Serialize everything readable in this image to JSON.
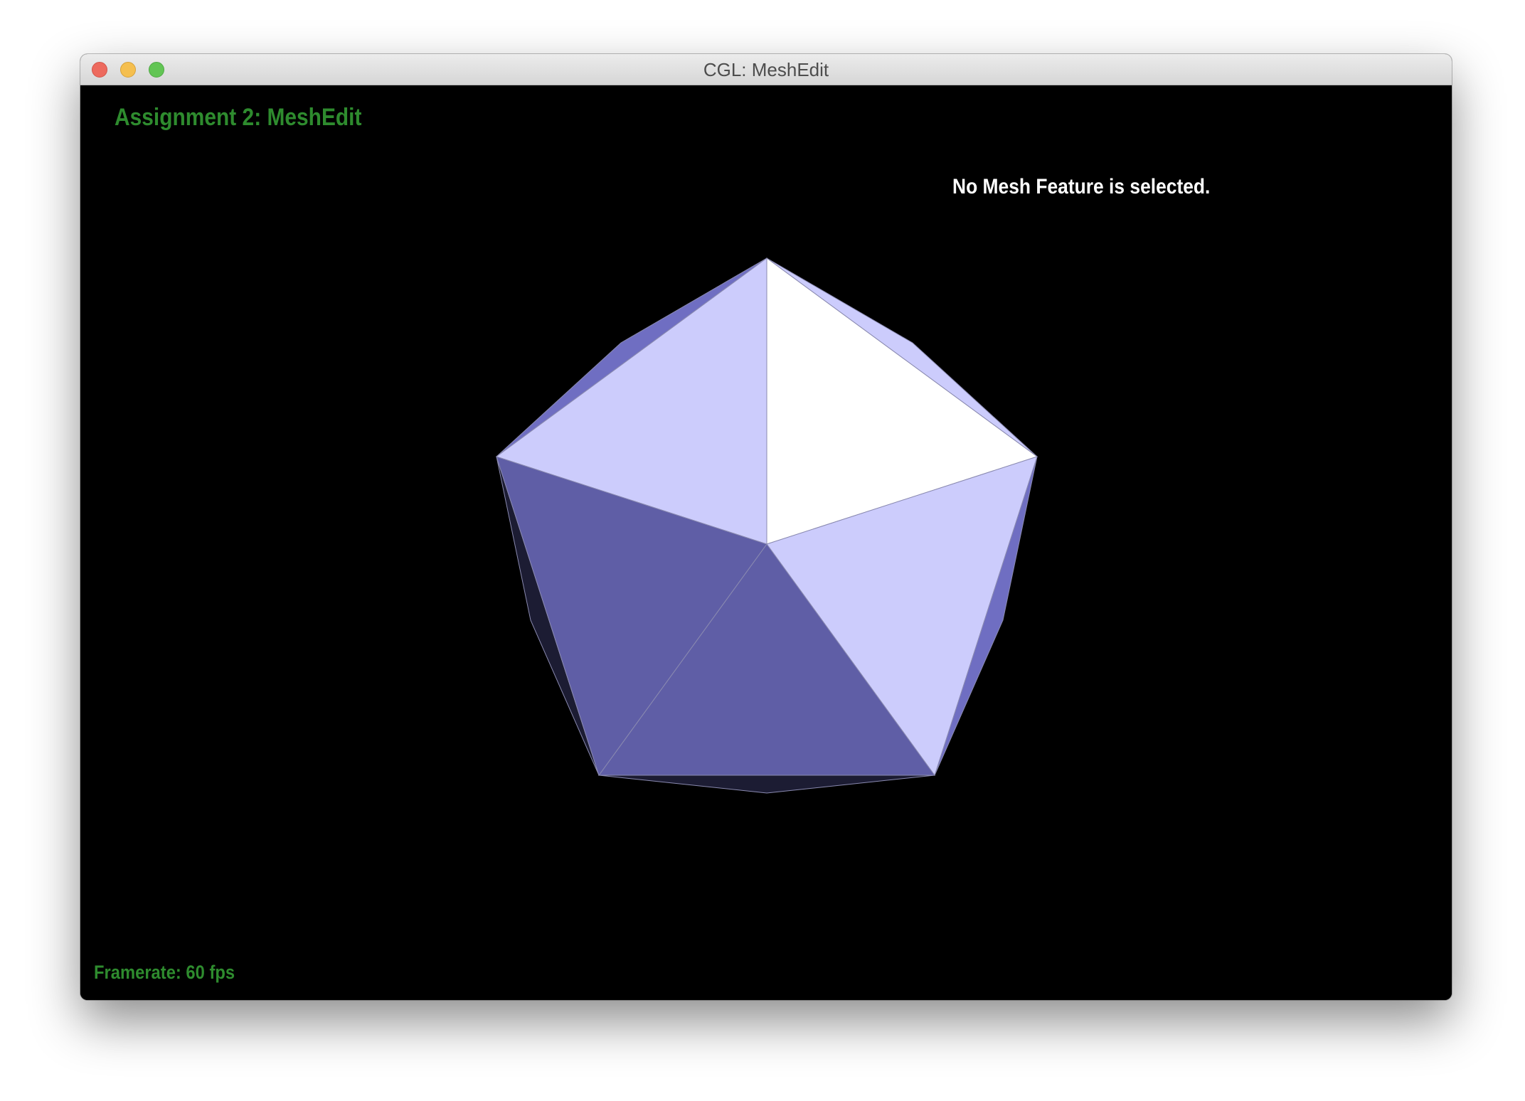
{
  "window": {
    "title": "CGL: MeshEdit"
  },
  "viewport": {
    "heading": "Assignment 2: MeshEdit",
    "status_message": "No Mesh Feature is selected.",
    "framerate_label": "Framerate: 60 fps"
  },
  "colors": {
    "heading": "#2e8b2e",
    "status": "#ffffff",
    "framerate": "#2e8b2e",
    "background": "#000000",
    "face_light": "#ccccfc",
    "face_white": "#ffffff",
    "face_mid": "#5f5ea6",
    "face_side": "#6f6ec2",
    "face_dark": "#1c1c33",
    "edge": "#8a8ab0"
  },
  "icons": {
    "close": "close-icon",
    "minimize": "minimize-icon",
    "maximize": "maximize-icon"
  },
  "mesh": {
    "shape": "icosahedron",
    "selected_feature": null
  }
}
